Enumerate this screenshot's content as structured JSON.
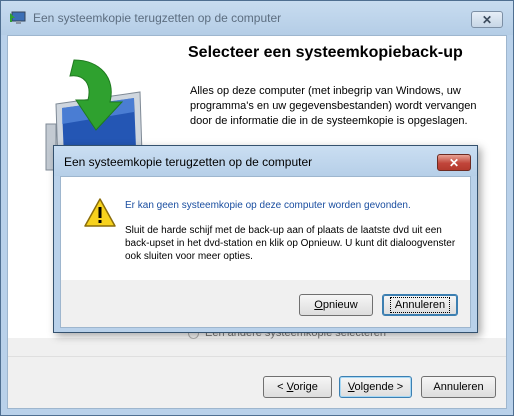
{
  "window": {
    "title": "Een systeemkopie terugzetten op de computer",
    "close_glyph": "✕",
    "heading": "Selecteer een systeemkopieback-up",
    "description": "Alles op deze computer (met inbegrip van Windows, uw programma's en uw gegevensbestanden) wordt vervangen door de informatie die in de systeemkopie is opgeslagen.",
    "radio_label": "Een andere systeemkopie selecteren",
    "buttons": {
      "back_prefix": "< ",
      "back_key": "V",
      "back_rest": "orige",
      "next_key": "V",
      "next_label_rest": "olgende >",
      "next_prefix": "",
      "cancel": "Annuleren"
    }
  },
  "dialog": {
    "title": "Een systeemkopie terugzetten op de computer",
    "close_glyph": "✕",
    "main_instruction": "Er kan geen systeemkopie op deze computer worden gevonden.",
    "content": "Sluit de harde schijf met de back-up aan of plaats de laatste dvd uit een back-upset in het dvd-station en klik op Opnieuw. U kunt dit dialoogvenster ook sluiten voor meer opties.",
    "buttons": {
      "retry_key": "O",
      "retry_rest": "pnieuw",
      "cancel": "Annuleren"
    }
  },
  "icons": {
    "window_icon": "restore-computer-icon",
    "illustration": "monitor-restore-arrow-icon",
    "warning": "warning-triangle-icon"
  },
  "colors": {
    "frame": "#b9d1ea",
    "link_blue": "#1a4ea0",
    "close_red": "#c0453a",
    "arrow_green": "#2fa12f"
  }
}
